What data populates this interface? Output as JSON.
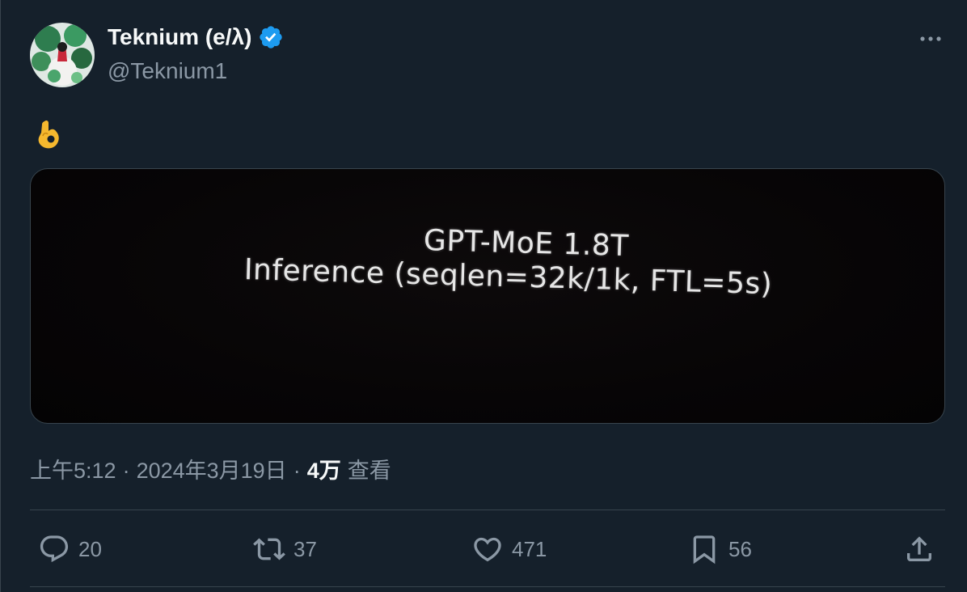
{
  "author": {
    "display_name": "Teknium (e/λ)",
    "handle": "@Teknium1",
    "verified_icon": "verified-badge-icon",
    "avatar": "avatar-image"
  },
  "tweet": {
    "text_emoji": "ok-hand-emoji",
    "media_text": {
      "line1": "GPT-MoE 1.8T",
      "line2": "Inference (seqlen=32k/1k, FTL=5s)"
    }
  },
  "meta": {
    "time": "上午5:12",
    "separator": "·",
    "date": "2024年3月19日",
    "views_count": "4万",
    "views_label": "查看"
  },
  "actions": {
    "replies": "20",
    "retweets": "37",
    "likes": "471",
    "bookmarks": "56"
  },
  "colors": {
    "background": "#15202b",
    "text_primary": "#f7f9f9",
    "text_secondary": "#8b98a5",
    "border": "#38444d",
    "verified_blue": "#1d9bf0",
    "emoji_yellow": "#f5b82e"
  }
}
